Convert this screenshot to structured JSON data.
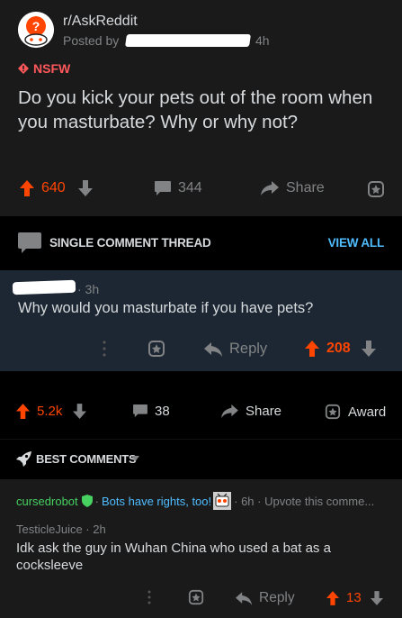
{
  "post": {
    "subreddit": "r/AskReddit",
    "posted_by_label": "Posted by",
    "age": "4h",
    "nsfw_label": "NSFW",
    "title": "Do you kick your pets out of the room when you masturbate? Why or why not?",
    "score": "640",
    "comment_count": "344",
    "share_label": "Share"
  },
  "thread_bar": {
    "label": "SINGLE COMMENT THREAD",
    "view_all": "VIEW ALL"
  },
  "highlighted_comment": {
    "age": "· 3h",
    "body": "Why would you masturbate if you have pets?",
    "reply_label": "Reply",
    "score": "208"
  },
  "post_actions2": {
    "score": "5.2k",
    "comment_count": "38",
    "share_label": "Share",
    "award_label": "Award"
  },
  "sort_bar": {
    "label": "BEST COMMENTS"
  },
  "bot_comment": {
    "author": "cursedrobot",
    "flair": "Bots have rights, too!",
    "meta": "· 6h · Upvote this comme...",
    "separator": "·"
  },
  "reply_comment": {
    "author_line": "TesticleJuice · 2h",
    "body": "Idk ask the guy in Wuhan China who used a bat as a cocksleeve",
    "reply_label": "Reply",
    "score": "13"
  },
  "colors": {
    "upvote": "#ff4500",
    "link_blue": "#4fbcff",
    "bot_green": "#46d160",
    "nsfw_red": "#ff585b",
    "highlight_bg": "#1c2733"
  }
}
